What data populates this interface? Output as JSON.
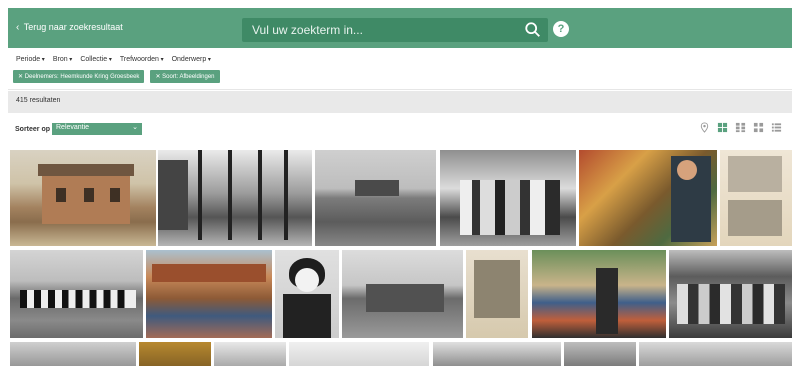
{
  "header": {
    "back_label": "Terug naar zoekresultaat",
    "search_placeholder": "Vul uw zoekterm in...",
    "help_label": "?"
  },
  "facets": [
    "Periode",
    "Bron",
    "Collectie",
    "Trefwoorden",
    "Onderwerp"
  ],
  "active_filters": [
    "Deelnemers: Heemkunde Kring Groesbeek",
    "Soort: Afbeeldingen"
  ],
  "results": {
    "count_label": "415 resultaten"
  },
  "sort": {
    "label": "Sorteer op",
    "value": "Relevantie"
  },
  "views": [
    "location-pin-icon",
    "grid-large-icon",
    "grid-medium-icon",
    "grid-small-icon",
    "list-icon"
  ],
  "colors": {
    "brand": "#5aa17f",
    "brand_dark": "#3f8a66",
    "panel": "#e9e9e9"
  }
}
